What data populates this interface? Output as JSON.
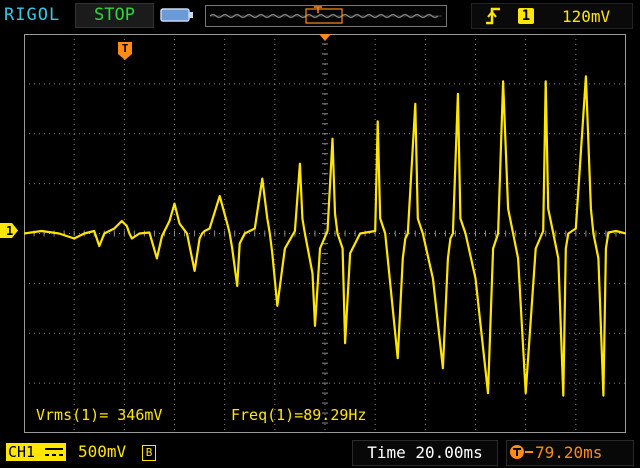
{
  "header": {
    "brand": "RIGOL",
    "run_state": "STOP",
    "trigger": {
      "slope_icon": "rising-edge-icon",
      "source": "1",
      "level": "120mV"
    }
  },
  "measurements": {
    "vrms": "Vrms(1)= 346mV",
    "freq": "Freq(1)=89.29Hz"
  },
  "footer": {
    "channel_label": "CH1",
    "channel_scale": "500mV",
    "bandwidth_badge": "B",
    "timebase": "Time 20.00ms",
    "trigger_offset": "79.20ms"
  },
  "markers": {
    "channel": "1",
    "trigger": "T"
  },
  "colors": {
    "ch1": "#ffe600",
    "brand": "#38c8e6",
    "trigger": "#ff8c19",
    "run": "#2fd63a",
    "grid": "#8a8a8a"
  },
  "chart_data": {
    "type": "line",
    "title": "",
    "xlabel": "",
    "ylabel": "",
    "grid": true,
    "grid_divisions": {
      "x": 12,
      "y": 8
    },
    "x_unit": "div",
    "y_unit": "div",
    "xlim": [
      0,
      12
    ],
    "ylim": [
      -4,
      4
    ],
    "series": [
      {
        "name": "",
        "color": "#ffe600",
        "x": [
          0,
          0.35,
          0.7,
          1.0,
          1.2,
          1.4,
          1.5,
          1.6,
          1.8,
          1.95,
          2.05,
          2.1,
          2.15,
          2.3,
          2.5,
          2.65,
          2.75,
          2.9,
          3.0,
          3.1,
          3.25,
          3.4,
          3.5,
          3.55,
          3.6,
          3.7,
          3.9,
          4.05,
          4.1,
          4.15,
          4.25,
          4.3,
          4.4,
          4.6,
          4.75,
          4.85,
          4.9,
          4.95,
          5.05,
          5.2,
          5.4,
          5.5,
          5.55,
          5.6,
          5.75,
          5.8,
          5.9,
          6.05,
          6.15,
          6.2,
          6.25,
          6.35,
          6.4,
          6.5,
          6.7,
          7.0,
          7.05,
          7.1,
          7.2,
          7.3,
          7.45,
          7.55,
          7.6,
          7.65,
          7.8,
          7.85,
          7.95,
          8.15,
          8.35,
          8.45,
          8.5,
          8.55,
          8.65,
          8.7,
          8.8,
          9.0,
          9.25,
          9.35,
          9.45,
          9.55,
          9.65,
          9.75,
          9.85,
          10.0,
          10.2,
          10.35,
          10.4,
          10.45,
          10.55,
          10.65,
          10.75,
          10.8,
          10.85,
          11.0,
          11.2,
          11.3,
          11.35,
          11.45,
          11.55,
          11.6,
          11.65,
          11.8,
          12.0
        ],
        "y": [
          0,
          0.05,
          0,
          -0.1,
          0,
          0.05,
          -0.25,
          0,
          0.1,
          0.25,
          0.15,
          0,
          -0.1,
          0,
          0.02,
          -0.5,
          -0.05,
          0.25,
          0.6,
          0.2,
          0,
          -0.75,
          -0.1,
          0,
          0.05,
          0.1,
          0.75,
          0.2,
          0,
          -0.3,
          -1.05,
          -0.2,
          0,
          0.1,
          1.1,
          0.3,
          0,
          -0.4,
          -1.45,
          -0.3,
          0.05,
          1.4,
          0.3,
          0,
          -0.8,
          -1.85,
          -0.3,
          0.05,
          1.9,
          0.4,
          0,
          -0.3,
          -2.2,
          -0.4,
          0,
          0.05,
          2.25,
          0.3,
          0,
          -1.0,
          -2.5,
          -0.5,
          -0.1,
          0,
          2.6,
          0.3,
          0,
          -0.9,
          -2.7,
          -0.5,
          -0.1,
          0,
          2.8,
          0.3,
          0,
          -0.9,
          -3.2,
          -0.3,
          0,
          3.05,
          0.5,
          0,
          -0.5,
          -3.2,
          -0.3,
          0.05,
          3.05,
          0.5,
          0,
          -0.5,
          -3.25,
          -0.3,
          0,
          0.1,
          3.15,
          0.5,
          0,
          -0.5,
          -3.25,
          -0.3,
          0.02,
          0.05,
          0
        ]
      }
    ]
  }
}
